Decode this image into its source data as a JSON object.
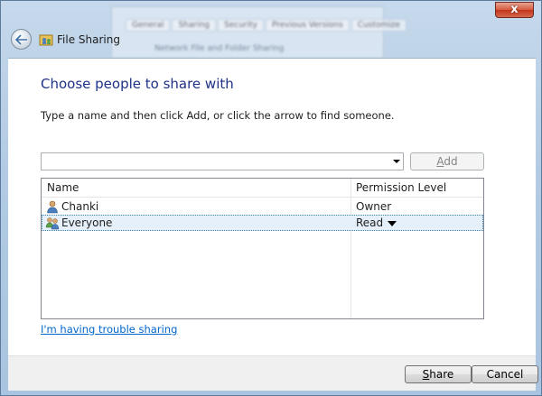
{
  "window": {
    "title": "File Sharing",
    "close_label": "x"
  },
  "background_window": {
    "title": "",
    "tabs": [
      "General",
      "Sharing",
      "Security",
      "Previous Versions",
      "Customize"
    ],
    "subtitle": "Network File and Folder Sharing"
  },
  "main": {
    "heading": "Choose people to share with",
    "instruction": "Type a name and then click Add, or click the arrow to find someone.",
    "name_input": {
      "value": "",
      "placeholder": ""
    },
    "add_label_first": "A",
    "add_label_rest": "dd"
  },
  "list": {
    "columns": [
      "Name",
      "Permission Level"
    ],
    "rows": [
      {
        "name": "Chanki",
        "permission": "Owner",
        "icon": "user-icon"
      },
      {
        "name": "Everyone",
        "permission": "Read",
        "icon": "group-icon",
        "selected": true
      }
    ]
  },
  "links": {
    "trouble": "I'm having trouble sharing"
  },
  "footer": {
    "share_first": "S",
    "share_rest": "hare",
    "cancel_label": "Cancel"
  },
  "colors": {
    "heading": "#1e3287",
    "link": "#0066cc",
    "selection": "#e6f0fa"
  }
}
